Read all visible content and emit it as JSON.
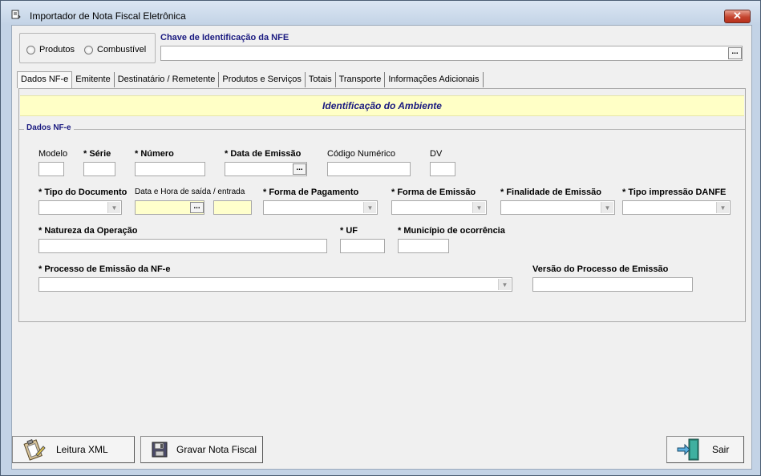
{
  "window": {
    "title": "Importador de Nota Fiscal Eletrônica",
    "app_icon": "document-icon",
    "close_glyph": "✕"
  },
  "product_type": {
    "options": [
      {
        "label": "Produtos",
        "selected": false
      },
      {
        "label": "Combustível",
        "selected": false
      }
    ]
  },
  "nfe_key": {
    "label": "Chave de Identificação da NFE",
    "value": "",
    "button_label": "..."
  },
  "tabs": [
    {
      "label": "Dados NF-e",
      "active": true
    },
    {
      "label": "Emitente",
      "active": false
    },
    {
      "label": "Destinatário / Remetente",
      "active": false
    },
    {
      "label": "Produtos e Serviços",
      "active": false
    },
    {
      "label": "Totais",
      "active": false
    },
    {
      "label": "Transporte",
      "active": false
    },
    {
      "label": "Informações Adicionais",
      "active": false
    }
  ],
  "panel": {
    "header": "Identificação do Ambiente",
    "group_caption": "Dados NF-e",
    "fields": {
      "modelo": {
        "label": "Modelo",
        "value": ""
      },
      "serie": {
        "label": "* Série",
        "value": ""
      },
      "numero": {
        "label": "* Número",
        "value": ""
      },
      "data_emissao": {
        "label": "* Data de Emissão",
        "value": "",
        "button_label": "..."
      },
      "codigo_numerico": {
        "label": "Código Numérico",
        "value": ""
      },
      "dv": {
        "label": "DV",
        "value": ""
      },
      "tipo_documento": {
        "label": "* Tipo do Documento",
        "value": ""
      },
      "data_hora_saida": {
        "label": "Data e Hora de saída / entrada",
        "date_value": "",
        "time_value": "",
        "button_label": "..."
      },
      "forma_pagamento": {
        "label": "* Forma de Pagamento",
        "value": ""
      },
      "forma_emissao": {
        "label": "* Forma de Emissão",
        "value": ""
      },
      "finalidade_emissao": {
        "label": "* Finalidade de Emissão",
        "value": ""
      },
      "tipo_impressao": {
        "label": "* Tipo impressão DANFE",
        "value": ""
      },
      "natureza_operacao": {
        "label": "* Natureza da Operação",
        "value": ""
      },
      "uf": {
        "label": "* UF",
        "value": ""
      },
      "municipio": {
        "label": "* Município de ocorrência",
        "value": ""
      },
      "processo_emissao": {
        "label": "* Processo de Emissão da NF-e",
        "value": ""
      },
      "versao_processo": {
        "label": "Versão do Processo de Emissão",
        "value": ""
      }
    }
  },
  "buttons": {
    "leitura_xml": {
      "label": "Leitura XML",
      "icon": "clipboard-icon"
    },
    "gravar": {
      "label": "Gravar Nota Fiscal",
      "icon": "floppy-disk-icon"
    },
    "sair": {
      "label": "Sair",
      "icon": "exit-door-icon"
    }
  },
  "colors": {
    "accent_label": "#1a1a80",
    "highlight_field": "#ffffcc",
    "header_band": "#ffffc6"
  }
}
